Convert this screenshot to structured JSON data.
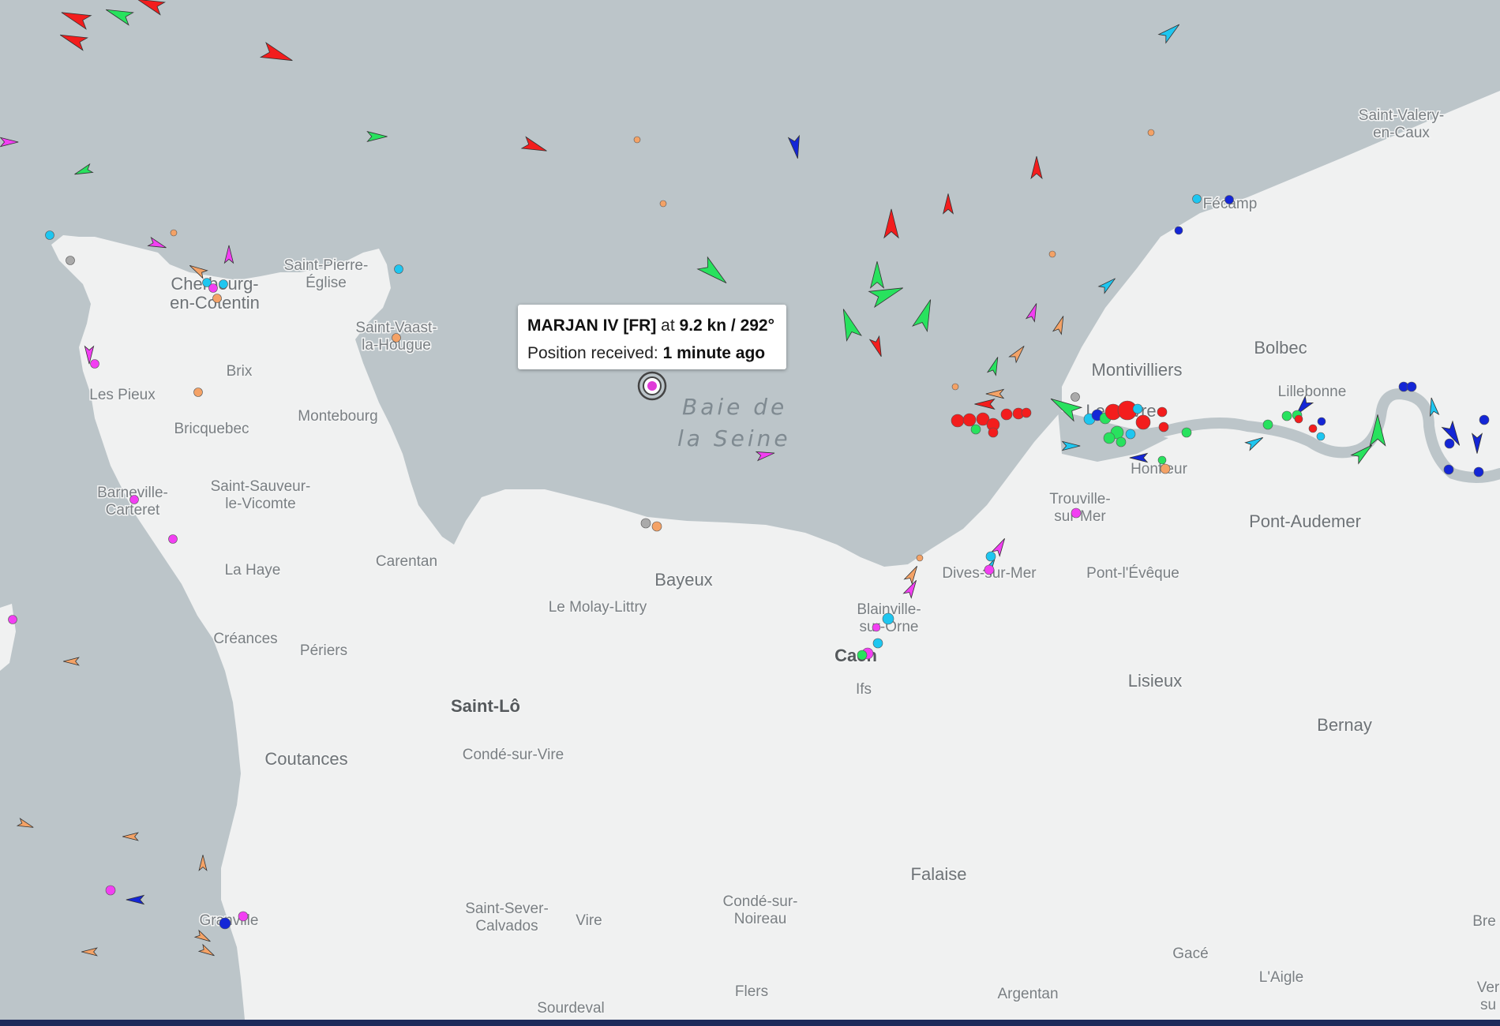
{
  "map": {
    "sea_label_line1": "Baie de",
    "sea_label_line2": "la Seine",
    "places": [
      {
        "id": "saint-valery",
        "lines": [
          "Saint-Valery-",
          "en-Caux"
        ]
      },
      {
        "id": "fecamp",
        "lines": [
          "Fécamp"
        ]
      },
      {
        "id": "saint-pierre-eglise",
        "lines": [
          "Saint-Pierre-",
          "Église"
        ]
      },
      {
        "id": "cherbourg",
        "lines": [
          "Cherbourg-",
          "en-Cotentin"
        ]
      },
      {
        "id": "saint-vaast",
        "lines": [
          "Saint-Vaast-",
          "la-Hougue"
        ]
      },
      {
        "id": "bolbec",
        "lines": [
          "Bolbec"
        ]
      },
      {
        "id": "montivilliers",
        "lines": [
          "Montivilliers"
        ]
      },
      {
        "id": "lillebonne",
        "lines": [
          "Lillebonne"
        ]
      },
      {
        "id": "brix",
        "lines": [
          "Brix"
        ]
      },
      {
        "id": "les-pieux",
        "lines": [
          "Les Pieux"
        ]
      },
      {
        "id": "montebourg",
        "lines": [
          "Montebourg"
        ]
      },
      {
        "id": "bricquebec",
        "lines": [
          "Bricquebec"
        ]
      },
      {
        "id": "le-havre",
        "lines": [
          "Le Havre"
        ]
      },
      {
        "id": "honfleur",
        "lines": [
          "Honfleur"
        ]
      },
      {
        "id": "barneville",
        "lines": [
          "Barneville-",
          "Carteret"
        ]
      },
      {
        "id": "saint-sauveur",
        "lines": [
          "Saint-Sauveur-",
          "le-Vicomte"
        ]
      },
      {
        "id": "trouville",
        "lines": [
          "Trouville-",
          "sur-Mer"
        ]
      },
      {
        "id": "pont-audemer",
        "lines": [
          "Pont-Audemer"
        ]
      },
      {
        "id": "carentan",
        "lines": [
          "Carentan"
        ]
      },
      {
        "id": "la-haye",
        "lines": [
          "La Haye"
        ]
      },
      {
        "id": "dives",
        "lines": [
          "Dives-sur-Mer"
        ]
      },
      {
        "id": "pont-leveque",
        "lines": [
          "Pont-l'Évêque"
        ]
      },
      {
        "id": "bayeux",
        "lines": [
          "Bayeux"
        ]
      },
      {
        "id": "le-molay",
        "lines": [
          "Le Molay-Littry"
        ]
      },
      {
        "id": "blainville",
        "lines": [
          "Blainville-",
          "sur-Orne"
        ]
      },
      {
        "id": "creances",
        "lines": [
          "Créances"
        ]
      },
      {
        "id": "periers",
        "lines": [
          "Périers"
        ]
      },
      {
        "id": "caen",
        "lines": [
          "Caen"
        ]
      },
      {
        "id": "ifs",
        "lines": [
          "Ifs"
        ]
      },
      {
        "id": "lisieux",
        "lines": [
          "Lisieux"
        ]
      },
      {
        "id": "saint-lo",
        "lines": [
          "Saint-Lô"
        ]
      },
      {
        "id": "bernay",
        "lines": [
          "Bernay"
        ]
      },
      {
        "id": "coutances",
        "lines": [
          "Coutances"
        ]
      },
      {
        "id": "conde-sur-vire",
        "lines": [
          "Condé-sur-Vire"
        ]
      },
      {
        "id": "falaise",
        "lines": [
          "Falaise"
        ]
      },
      {
        "id": "conde-sur-noireau",
        "lines": [
          "Condé-sur-",
          "Noireau"
        ]
      },
      {
        "id": "saint-sever",
        "lines": [
          "Saint-Sever-",
          "Calvados"
        ]
      },
      {
        "id": "vire",
        "lines": [
          "Vire"
        ]
      },
      {
        "id": "granville",
        "lines": [
          "Granville"
        ]
      },
      {
        "id": "bre",
        "lines": [
          "Bre"
        ]
      },
      {
        "id": "gace",
        "lines": [
          "Gacé"
        ]
      },
      {
        "id": "laigle",
        "lines": [
          "L'Aigle"
        ]
      },
      {
        "id": "flers",
        "lines": [
          "Flers"
        ]
      },
      {
        "id": "argentan",
        "lines": [
          "Argentan"
        ]
      },
      {
        "id": "ver",
        "lines": [
          "Ver",
          "su"
        ]
      },
      {
        "id": "sourdeval",
        "lines": [
          "Sourdeval"
        ]
      }
    ]
  },
  "popup": {
    "vessel_name": "MARJAN IV [FR]",
    "at_text": "at",
    "speed_course": "9.2 kn / 292°",
    "position_label": "Position received:",
    "position_age": "1 minute ago"
  },
  "colors": {
    "sea": "#bcc5c9",
    "land": "#f0f1f1",
    "cargo": "#28e25e",
    "tanker": "#f31d1d",
    "passenger": "#1426d6",
    "tug": "#1ec6f0",
    "pleasure": "#f23ff2",
    "fishing": "#f4a266",
    "unknown": "#aaaaaa"
  }
}
